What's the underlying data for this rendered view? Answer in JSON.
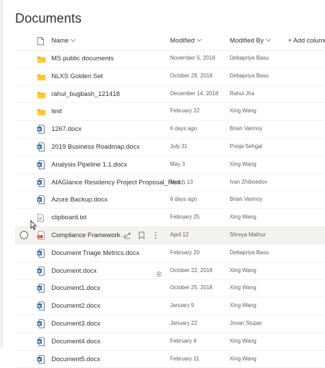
{
  "page": {
    "title": "Documents"
  },
  "columns": {
    "name": "Name",
    "modified": "Modified",
    "modified_by": "Modified By",
    "add_column": "+ Add column"
  },
  "colors": {
    "folder": "#ffb900",
    "word": "#2b579a",
    "pdf": "#d13438",
    "hover_row": "#f3f2f1"
  },
  "rows": [
    {
      "name": "MS public documents",
      "modified": "November 5, 2018",
      "by": "Debapriya Basu",
      "icon": "folder-icon"
    },
    {
      "name": "NLXS Golden Set",
      "modified": "October 29, 2018",
      "by": "Debapriya Basu",
      "icon": "folder-icon"
    },
    {
      "name": "rahul_bugbash_121418",
      "modified": "December 14, 2018",
      "by": "Rahul Jha",
      "icon": "folder-icon"
    },
    {
      "name": "test",
      "modified": "February 22",
      "by": "Xing Wang",
      "icon": "folder-icon"
    },
    {
      "name": "1267.docx",
      "modified": "6 days ago",
      "by": "Brian Vannoy",
      "icon": "word-icon"
    },
    {
      "name": "2019 Business Roadmap.docx",
      "modified": "July 31",
      "by": "Pooja Sehgal",
      "icon": "word-icon"
    },
    {
      "name": "Analysis Pipeline 1.1.docx",
      "modified": "May 3",
      "by": "Xing Wang",
      "icon": "word-icon"
    },
    {
      "name": "AtAGlance Residency Project Proposal_Red...",
      "modified": "March 13",
      "by": "Ivan Zhiboedov",
      "icon": "word-icon"
    },
    {
      "name": "Azure Backup.docx",
      "modified": "6 days ago",
      "by": "Brian Vannoy",
      "icon": "word-icon"
    },
    {
      "name": "clipboard.txt",
      "modified": "February 25",
      "by": "Xing Wang",
      "icon": "text-file-icon"
    },
    {
      "name": "Compliance Framework d...",
      "modified": "April 12",
      "by": "Shreya Mathur",
      "icon": "pdf-icon"
    },
    {
      "name": "Document Triage Metrics.docx",
      "modified": "February 20",
      "by": "Debapriya Basu",
      "icon": "word-icon"
    },
    {
      "name": "Document.docx",
      "modified": "October 22, 2018",
      "by": "Xing Wang",
      "icon": "word-icon"
    },
    {
      "name": "Document1.docx",
      "modified": "October 25, 2018",
      "by": "Xing Wang",
      "icon": "word-icon"
    },
    {
      "name": "Document2.docx",
      "modified": "January 9",
      "by": "Xing Wang",
      "icon": "word-icon"
    },
    {
      "name": "Document3.docx",
      "modified": "January 22",
      "by": "Jovan Stupar",
      "icon": "word-icon"
    },
    {
      "name": "Document4.docx",
      "modified": "February 6",
      "by": "Xing Wang",
      "icon": "word-icon"
    },
    {
      "name": "Document5.docx",
      "modified": "February 11",
      "by": "Xing Wang",
      "icon": "word-icon"
    }
  ]
}
